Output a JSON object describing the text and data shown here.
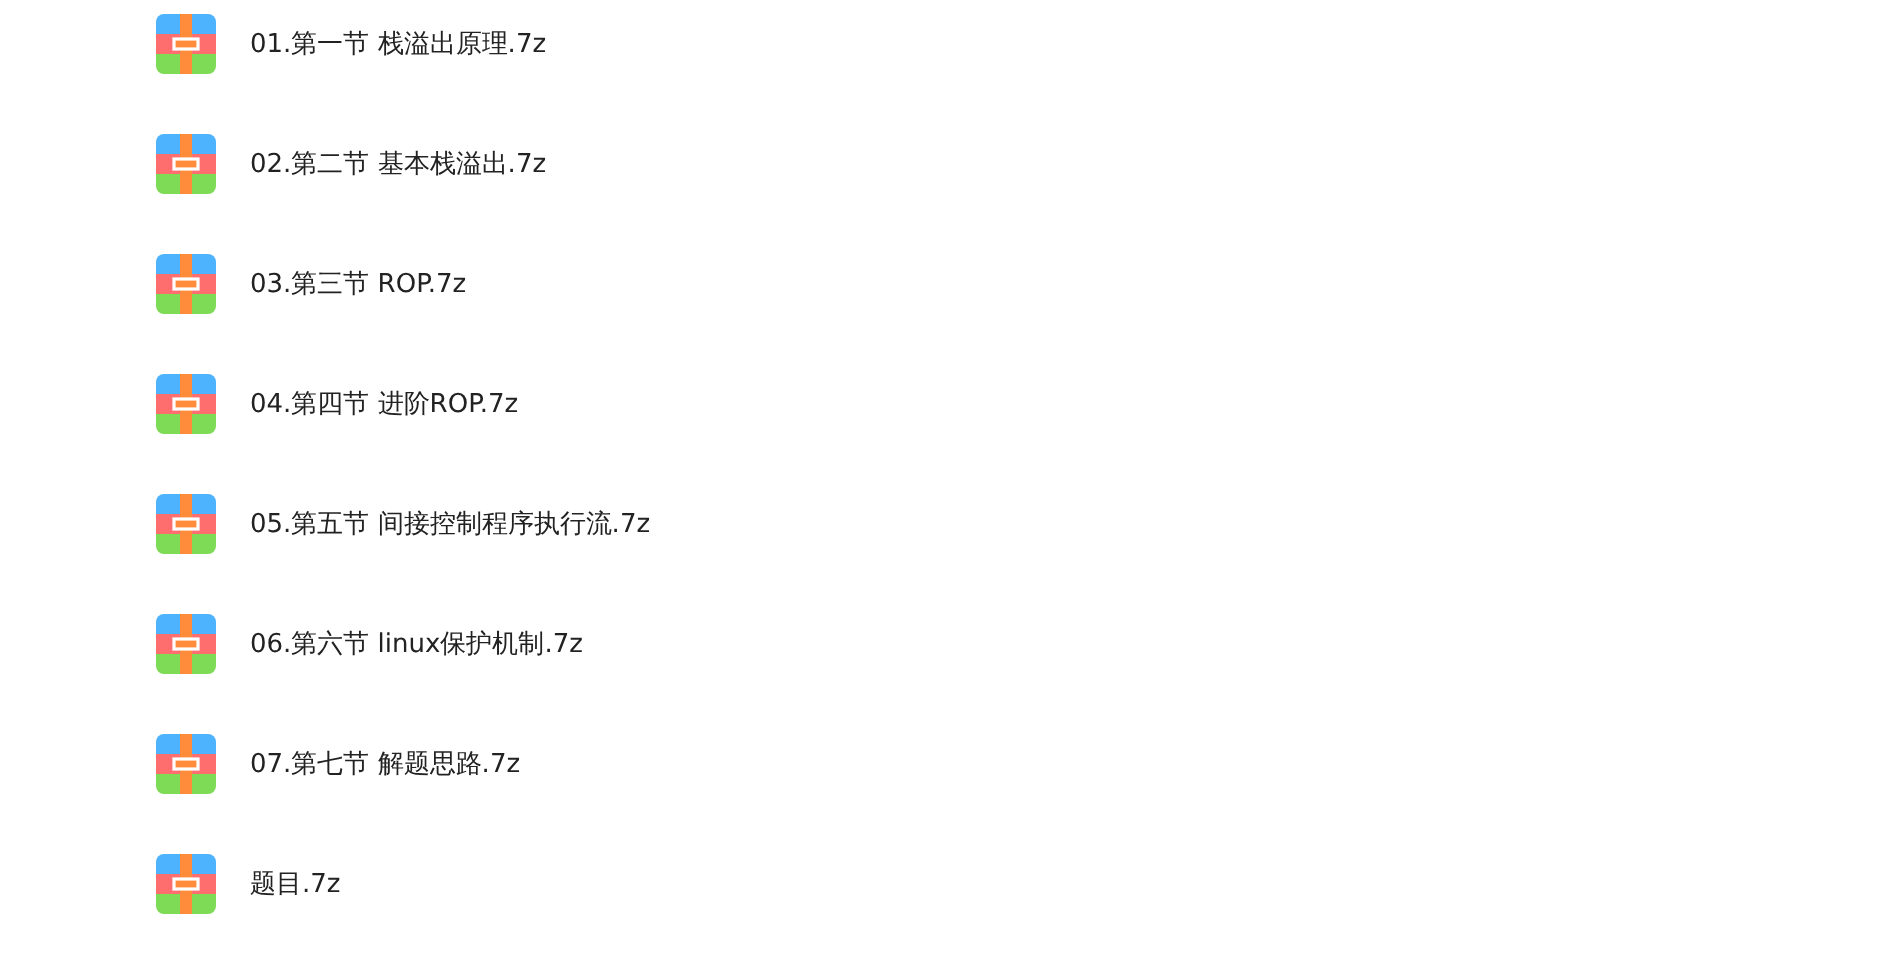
{
  "files": [
    {
      "name": "01.第一节 栈溢出原理.7z"
    },
    {
      "name": "02.第二节 基本栈溢出.7z"
    },
    {
      "name": "03.第三节 ROP.7z"
    },
    {
      "name": "04.第四节 进阶ROP.7z"
    },
    {
      "name": "05.第五节 间接控制程序执行流.7z"
    },
    {
      "name": "06.第六节 linux保护机制.7z"
    },
    {
      "name": "07.第七节 解题思路.7z"
    },
    {
      "name": "题目.7z"
    }
  ]
}
